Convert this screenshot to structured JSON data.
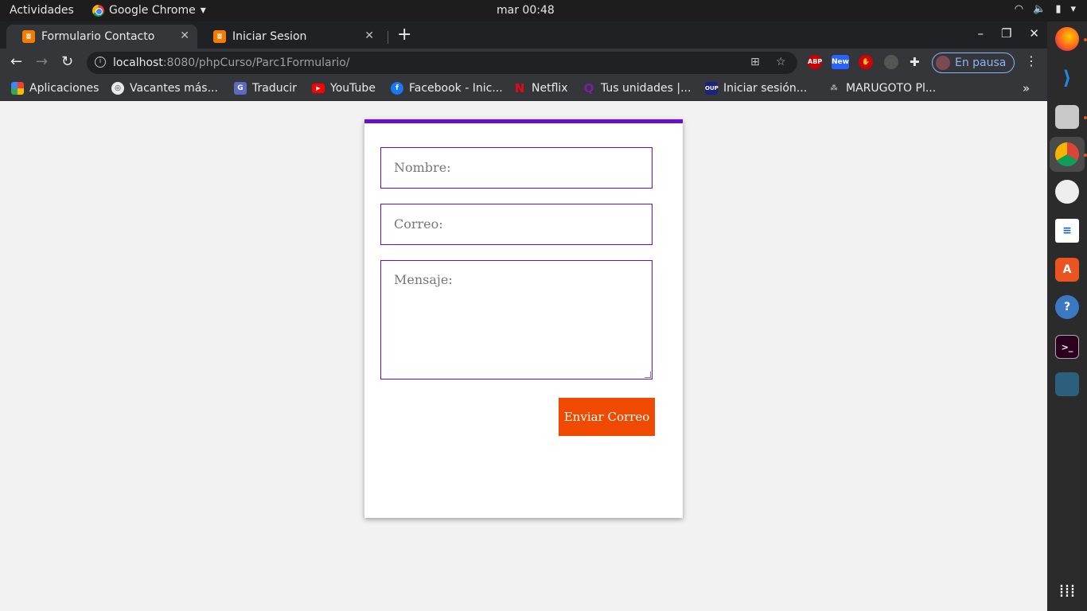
{
  "system_bar": {
    "activities": "Actividades",
    "app_name": "Google Chrome",
    "clock": "mar 00:48"
  },
  "browser": {
    "tabs": [
      {
        "label": "Formulario Contacto",
        "active": true
      },
      {
        "label": "Iniciar Sesion",
        "active": false
      }
    ],
    "address": {
      "host": "localhost",
      "path": ":8080/phpCurso/Parc1Formulario/"
    },
    "profile_label": "En pausa",
    "extensions": {
      "abp": "ABP",
      "new_badge": "New"
    },
    "bookmarks": [
      {
        "label": "Aplicaciones",
        "icon": "apps-grid-icon"
      },
      {
        "label": "Vacantes más...",
        "icon": "globe-icon"
      },
      {
        "label": "Traducir",
        "icon": "translate-icon"
      },
      {
        "label": "YouTube",
        "icon": "youtube-icon"
      },
      {
        "label": "Facebook - Inic...",
        "icon": "facebook-icon"
      },
      {
        "label": "Netflix",
        "icon": "netflix-icon"
      },
      {
        "label": "Tus unidades |...",
        "icon": "q-icon"
      },
      {
        "label": "Iniciar sesión...",
        "icon": "oup-icon",
        "icon_text": "OUP"
      },
      {
        "label": "MARUGOTO Pl...",
        "icon": "marugoto-icon"
      }
    ]
  },
  "form": {
    "name_placeholder": "Nombre:",
    "email_placeholder": "Correo:",
    "message_placeholder": "Mensaje:",
    "submit_label": "Enviar Correo",
    "accent_color": "#6a0dcc",
    "button_color": "#f04a00"
  },
  "dock": {
    "apps": [
      "firefox-icon",
      "vscode-icon",
      "files-icon",
      "chrome-icon",
      "rhythmbox-icon",
      "writer-icon",
      "software-icon",
      "help-icon",
      "terminal-icon",
      "mysql-workbench-icon"
    ]
  }
}
